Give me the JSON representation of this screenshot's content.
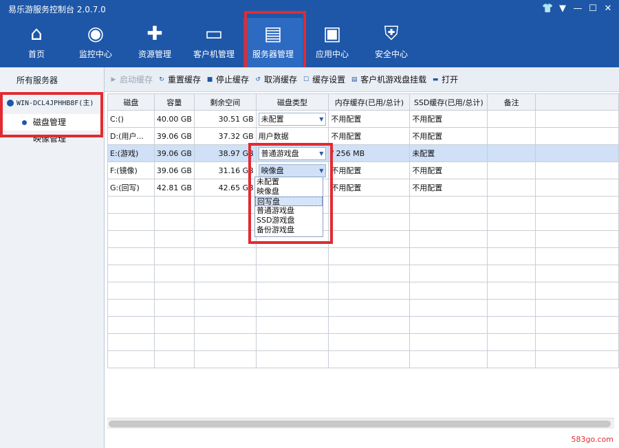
{
  "app": {
    "title": "易乐游服务控制台 2.0.7.0"
  },
  "window_controls": {
    "icons": [
      "shirt-icon",
      "dropdown-icon",
      "minimize-icon",
      "maximize-icon",
      "close-icon"
    ],
    "glyphs": [
      "👕",
      "▼",
      "—",
      "☐",
      "✕"
    ]
  },
  "nav": [
    {
      "label": "首页",
      "icon": "home-icon",
      "glyph": "⌂"
    },
    {
      "label": "监控中心",
      "icon": "eye-icon",
      "glyph": "◉"
    },
    {
      "label": "资源管理",
      "icon": "gamepad-icon",
      "glyph": "✚"
    },
    {
      "label": "客户机管理",
      "icon": "monitor-icon",
      "glyph": "▭"
    },
    {
      "label": "服务器管理",
      "icon": "server-icon",
      "glyph": "▤",
      "active": true
    },
    {
      "label": "应用中心",
      "icon": "toolbox-icon",
      "glyph": "▣"
    },
    {
      "label": "安全中心",
      "icon": "shield-icon",
      "glyph": "⛨"
    }
  ],
  "sidebar": {
    "header": "所有服务器",
    "server": "WIN-DCL4JPHHB8F(主)",
    "items": [
      "磁盘管理",
      "映像管理"
    ]
  },
  "toolbar": [
    {
      "label": "启动缓存",
      "icon": "play-icon",
      "glyph": "▶",
      "disabled": true
    },
    {
      "label": "重置缓存",
      "icon": "reset-icon",
      "glyph": "↻"
    },
    {
      "label": "停止缓存",
      "icon": "stop-icon",
      "glyph": "■"
    },
    {
      "label": "取消缓存",
      "icon": "cancel-icon",
      "glyph": "↺"
    },
    {
      "label": "缓存设置",
      "icon": "checkbox-icon",
      "glyph": "☐"
    },
    {
      "label": "客户机游戏盘挂载",
      "icon": "mount-icon",
      "glyph": "▤"
    },
    {
      "label": "打开",
      "icon": "folder-icon",
      "glyph": "▬"
    }
  ],
  "table": {
    "headers": [
      "磁盘",
      "容量",
      "剩余空间",
      "磁盘类型",
      "内存缓存(已用/总计)",
      "SSD缓存(已用/总计)",
      "备注"
    ],
    "rows": [
      {
        "disk": "C:()",
        "cap": "40.00 GB",
        "free": "30.51 GB",
        "type": "未配置",
        "combo": true,
        "mem": "不用配置",
        "ssd": "不用配置"
      },
      {
        "disk": "D:(用户...",
        "cap": "39.06 GB",
        "free": "37.32 GB",
        "type": "用户数据",
        "combo": false,
        "mem": "不用配置",
        "ssd": "不用配置"
      },
      {
        "disk": "E:(游戏)",
        "cap": "39.06 GB",
        "free": "38.97 GB",
        "type": "普通游戏盘",
        "combo": true,
        "mem": "/ 256 MB",
        "ssd": "未配置",
        "selected": true
      },
      {
        "disk": "F:(镜像)",
        "cap": "39.06 GB",
        "free": "31.16 GB",
        "type": "映像盘",
        "combo": true,
        "mem": "不用配置",
        "ssd": "不用配置",
        "blue": true
      },
      {
        "disk": "G:(回写)",
        "cap": "42.81 GB",
        "free": "42.65 GB",
        "type": "",
        "combo": false,
        "mem": "不用配置",
        "ssd": "不用配置"
      }
    ]
  },
  "dropdown": {
    "options": [
      "未配置",
      "映像盘",
      "回写盘",
      "普通游戏盘",
      "SSD游戏盘",
      "备份游戏盘"
    ],
    "highlighted": "回写盘"
  },
  "watermark": "583go.com"
}
